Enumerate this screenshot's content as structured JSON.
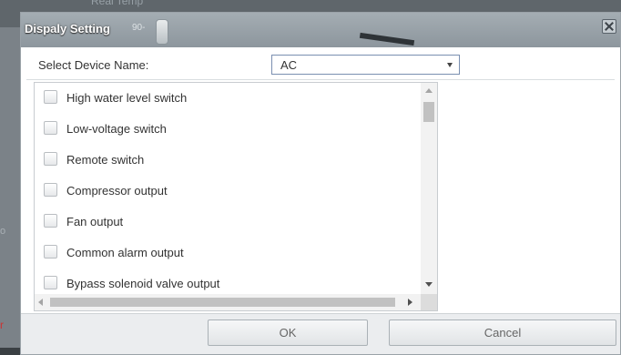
{
  "dialog": {
    "title": "Dispaly Setting",
    "title_ghost_text": "90-",
    "close_icon": "close-icon"
  },
  "background": {
    "ghost_text": "Real Temp",
    "edge_text_left": "o",
    "edge_text_red": "r"
  },
  "device_select": {
    "label": "Select Device Name:",
    "value": "AC"
  },
  "items": [
    {
      "label": "High water level switch",
      "checked": false
    },
    {
      "label": "Low-voltage switch",
      "checked": false
    },
    {
      "label": "Remote switch",
      "checked": false
    },
    {
      "label": "Compressor output",
      "checked": false
    },
    {
      "label": "Fan output",
      "checked": false
    },
    {
      "label": "Common alarm output",
      "checked": false
    },
    {
      "label": "Bypass solenoid valve output",
      "checked": false
    }
  ],
  "buttons": {
    "ok": "OK",
    "cancel": "Cancel"
  }
}
